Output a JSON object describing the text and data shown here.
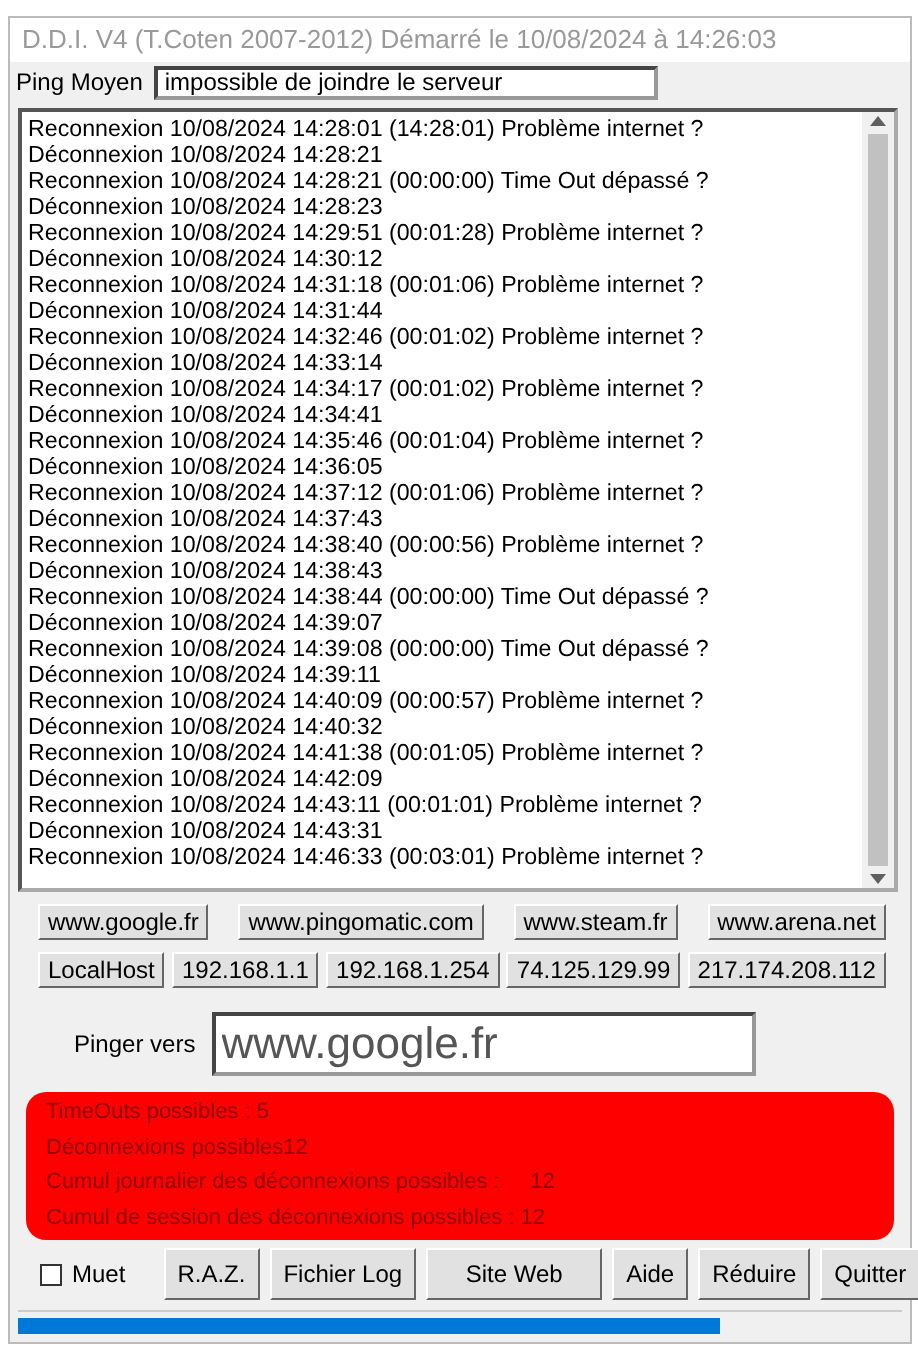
{
  "window": {
    "title": "D.D.I. V4 (T.Coten 2007-2012) Démarré le 10/08/2024 à 14:26:03"
  },
  "ping_moyen": {
    "label": "Ping Moyen",
    "value": "impossible de joindre le serveur"
  },
  "log": [
    "Reconnexion 10/08/2024 14:28:01 (14:28:01) Problème internet ?",
    "Déconnexion 10/08/2024 14:28:21",
    "Reconnexion 10/08/2024 14:28:21 (00:00:00) Time Out dépassé ?",
    "Déconnexion 10/08/2024 14:28:23",
    "Reconnexion 10/08/2024 14:29:51 (00:01:28) Problème internet ?",
    "Déconnexion 10/08/2024 14:30:12",
    "Reconnexion 10/08/2024 14:31:18 (00:01:06) Problème internet ?",
    "Déconnexion 10/08/2024 14:31:44",
    "Reconnexion 10/08/2024 14:32:46 (00:01:02) Problème internet ?",
    "Déconnexion 10/08/2024 14:33:14",
    "Reconnexion 10/08/2024 14:34:17 (00:01:02) Problème internet ?",
    "Déconnexion 10/08/2024 14:34:41",
    "Reconnexion 10/08/2024 14:35:46 (00:01:04) Problème internet ?",
    "Déconnexion 10/08/2024 14:36:05",
    "Reconnexion 10/08/2024 14:37:12 (00:01:06) Problème internet ?",
    "Déconnexion 10/08/2024 14:37:43",
    "Reconnexion 10/08/2024 14:38:40 (00:00:56) Problème internet ?",
    "Déconnexion 10/08/2024 14:38:43",
    "Reconnexion 10/08/2024 14:38:44 (00:00:00) Time Out dépassé ?",
    "Déconnexion 10/08/2024 14:39:07",
    "Reconnexion 10/08/2024 14:39:08 (00:00:00) Time Out dépassé ?",
    "Déconnexion 10/08/2024 14:39:11",
    "Reconnexion 10/08/2024 14:40:09 (00:00:57) Problème internet ?",
    "Déconnexion 10/08/2024 14:40:32",
    "Reconnexion 10/08/2024 14:41:38 (00:01:05) Problème internet ?",
    "Déconnexion 10/08/2024 14:42:09",
    "Reconnexion 10/08/2024 14:43:11 (00:01:01) Problème internet ?",
    "Déconnexion 10/08/2024 14:43:31",
    "Reconnexion 10/08/2024 14:46:33 (00:03:01) Problème internet ?"
  ],
  "host_buttons": [
    [
      "www.google.fr",
      "www.pingomatic.com",
      "www.steam.fr",
      "www.arena.net"
    ],
    [
      "LocalHost",
      "192.168.1.1",
      "192.168.1.254",
      "74.125.129.99",
      "217.174.208.112"
    ]
  ],
  "pinger_vers": {
    "label": "Pinger vers",
    "value": "www.google.fr"
  },
  "alerts": [
    "TimeOuts possibles : 5",
    "Déconnexions possibles12",
    "Cumul journalier des déconnexions possibles :     12",
    "Cumul de session des déconnexions possibles : 12"
  ],
  "muet": {
    "label": "Muet",
    "checked": false
  },
  "buttons": [
    "R.A.Z.",
    "Fichier Log",
    "Site Web",
    "Aide",
    "Réduire",
    "Quitter"
  ],
  "progress": {
    "level": 0.795
  }
}
